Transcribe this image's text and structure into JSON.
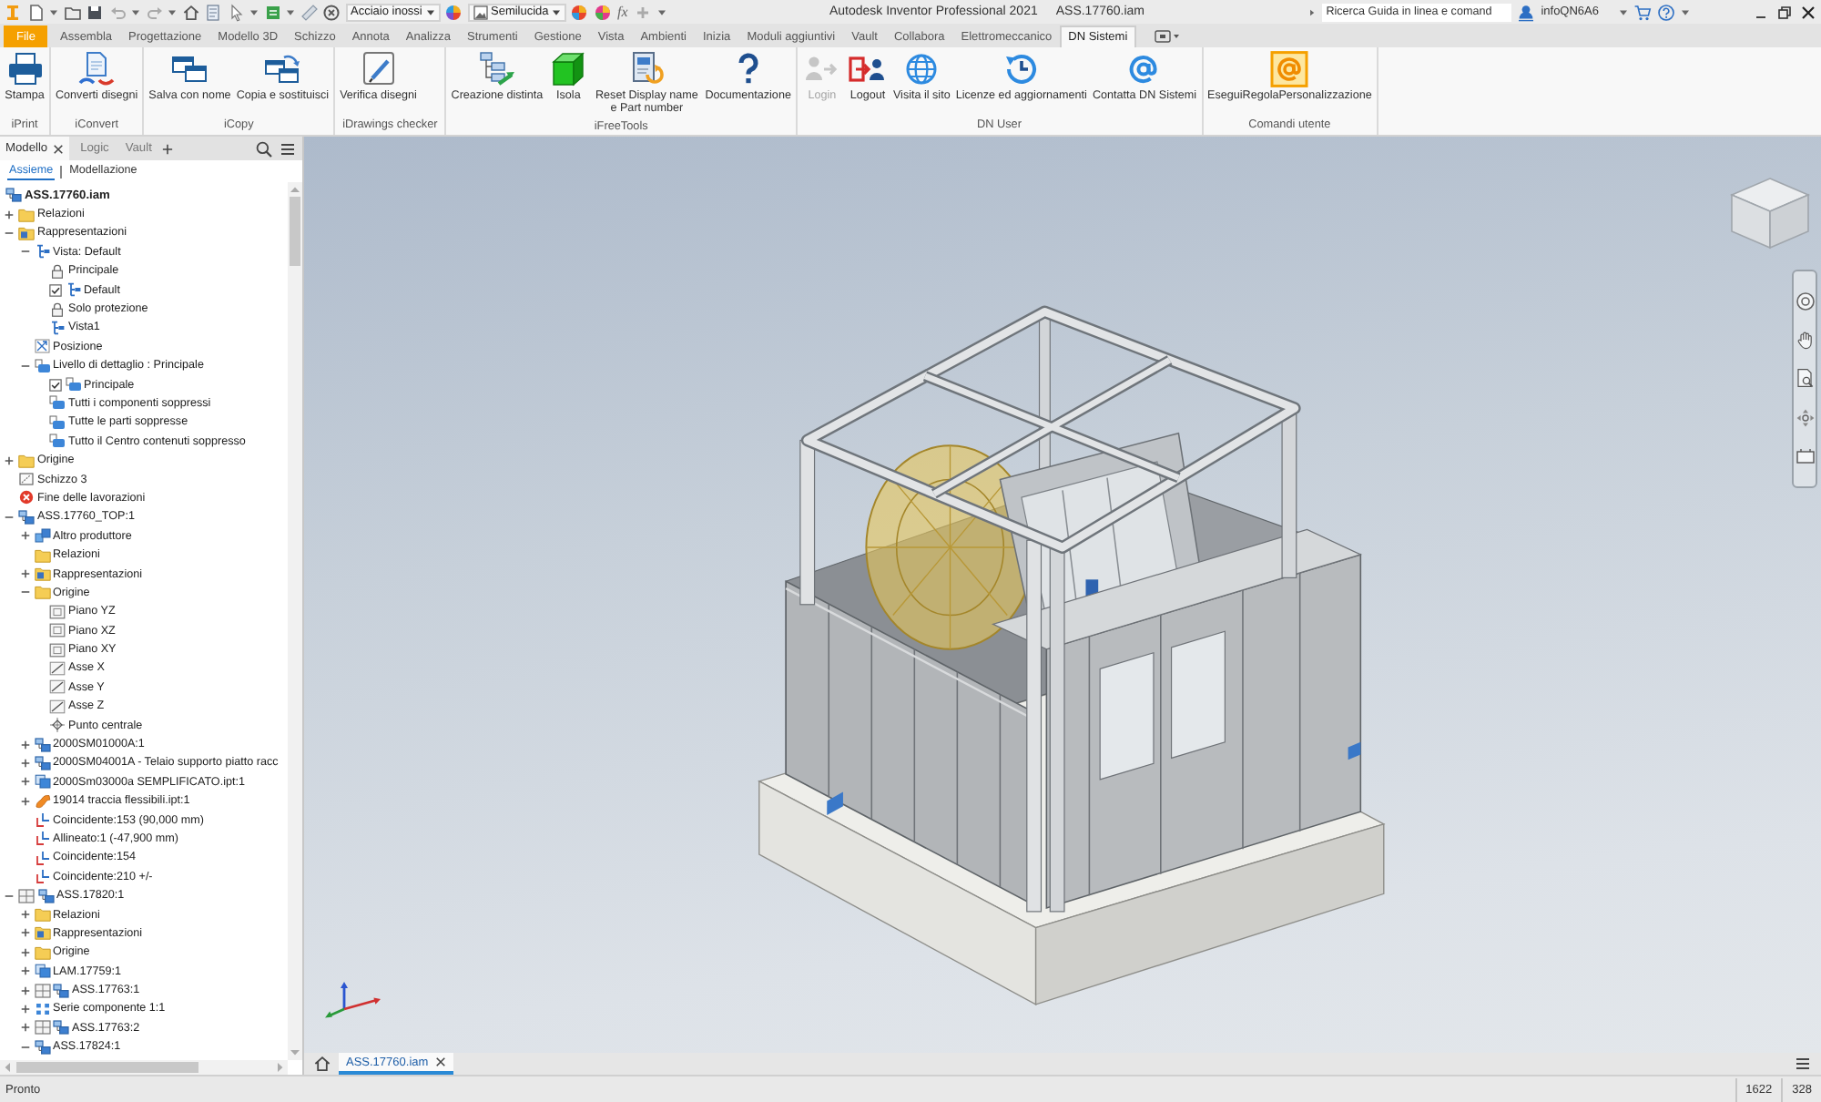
{
  "title_bar": {
    "material": "Acciaio inossi",
    "appearance": "Semilucida",
    "formula_button": "fx",
    "title": "Autodesk Inventor Professional 2021",
    "document": "ASS.17760.iam",
    "search": {
      "placeholder": "Ricerca Guida in linea e comand"
    },
    "user": "infoQN6A6"
  },
  "ribbon_tabs": [
    {
      "label": "File",
      "kind": "application_menu",
      "selected": false
    },
    {
      "label": "Assembla",
      "kind": "tab",
      "selected": false
    },
    {
      "label": "Progettazione",
      "kind": "tab",
      "selected": false
    },
    {
      "label": "Modello 3D",
      "kind": "tab",
      "selected": false
    },
    {
      "label": "Schizzo",
      "kind": "tab",
      "selected": false
    },
    {
      "label": "Annota",
      "kind": "tab",
      "selected": false
    },
    {
      "label": "Analizza",
      "kind": "tab",
      "selected": false
    },
    {
      "label": "Strumenti",
      "kind": "tab",
      "selected": false
    },
    {
      "label": "Gestione",
      "kind": "tab",
      "selected": false
    },
    {
      "label": "Vista",
      "kind": "tab",
      "selected": false
    },
    {
      "label": "Ambienti",
      "kind": "tab",
      "selected": false
    },
    {
      "label": "Inizia",
      "kind": "tab",
      "selected": false
    },
    {
      "label": "Moduli aggiuntivi",
      "kind": "tab",
      "selected": false
    },
    {
      "label": "Vault",
      "kind": "tab",
      "selected": false
    },
    {
      "label": "Collabora",
      "kind": "tab",
      "selected": false
    },
    {
      "label": "Elettromeccanico",
      "kind": "tab",
      "selected": false
    },
    {
      "label": "DN Sistemi",
      "kind": "tab",
      "selected": true
    }
  ],
  "ribbon_groups": [
    {
      "label": "iPrint",
      "buttons": [
        {
          "label": "Stampa"
        }
      ]
    },
    {
      "label": "iConvert",
      "buttons": [
        {
          "label": "Converti disegni"
        }
      ]
    },
    {
      "label": "iCopy",
      "buttons": [
        {
          "label": "Salva con nome"
        },
        {
          "label": "Copia e sostituisci"
        }
      ]
    },
    {
      "label": "iDrawings checker",
      "buttons": [
        {
          "label": "Verifica disegni"
        }
      ]
    },
    {
      "label": "iFreeTools",
      "buttons": [
        {
          "label": "Creazione distinta"
        },
        {
          "label": "Isola"
        },
        {
          "label": "Reset Display name e Part number"
        },
        {
          "label": "Documentazione"
        }
      ]
    },
    {
      "label": "DN User",
      "buttons": [
        {
          "label": "Login",
          "disabled": true
        },
        {
          "label": "Logout",
          "disabled": false
        },
        {
          "label": "Visita il sito",
          "disabled": false
        },
        {
          "label": "Licenze ed aggiornamenti",
          "disabled": false
        },
        {
          "label": "Contatta DN Sistemi",
          "disabled": false
        }
      ]
    },
    {
      "label": "Comandi utente",
      "buttons": [
        {
          "label": "EseguiRegolaPersonalizzazione"
        }
      ]
    }
  ],
  "browser": {
    "tabs": [
      {
        "label": "Modello",
        "selected": true
      },
      {
        "label": "Logic",
        "selected": false
      },
      {
        "label": "Vault",
        "selected": false
      }
    ],
    "modes": [
      {
        "label": "Assieme",
        "selected": true
      },
      {
        "label": "Modellazione",
        "selected": false
      }
    ],
    "tree": {
      "label": "ASS.17760.iam",
      "kind": "assembly",
      "children": [
        {
          "label": "Relazioni",
          "kind": "folder",
          "expanded": false
        },
        {
          "label": "Rappresentazioni",
          "kind": "representations",
          "expanded": true,
          "children": [
            {
              "label": "Vista: Default",
              "kind": "view",
              "expanded": true,
              "children": [
                {
                  "label": "Principale",
                  "kind": "lock",
                  "checked": false
                },
                {
                  "label": "Default",
                  "kind": "view",
                  "checked": true
                },
                {
                  "label": "Solo protezione",
                  "kind": "lock",
                  "checked": false
                },
                {
                  "label": "Vista1",
                  "kind": "view",
                  "checked": false
                }
              ]
            },
            {
              "label": "Posizione",
              "kind": "position"
            },
            {
              "label": "Livello di dettaglio : Principale",
              "kind": "lod",
              "expanded": true,
              "children": [
                {
                  "label": "Principale",
                  "kind": "lod",
                  "checked": true
                },
                {
                  "label": "Tutti i componenti soppressi",
                  "kind": "lod",
                  "checked": false
                },
                {
                  "label": "Tutte le parti soppresse",
                  "kind": "lod",
                  "checked": false
                },
                {
                  "label": "Tutto il Centro contenuti soppresso",
                  "kind": "lod",
                  "checked": false
                }
              ]
            }
          ]
        },
        {
          "label": "Origine",
          "kind": "folder",
          "expanded": false
        },
        {
          "label": "Schizzo 3",
          "kind": "sketch"
        },
        {
          "label": "Fine delle lavorazioni",
          "kind": "end_marker"
        },
        {
          "label": "ASS.17760_TOP:1",
          "kind": "assembly",
          "expanded": true,
          "children": [
            {
              "label": "Altro produttore",
              "kind": "third_party",
              "expanded": false
            },
            {
              "label": "Relazioni",
              "kind": "folder"
            },
            {
              "label": "Rappresentazioni",
              "kind": "representations",
              "expanded": false
            },
            {
              "label": "Origine",
              "kind": "folder",
              "expanded": true,
              "children": [
                {
                  "label": "Piano YZ",
                  "kind": "plane"
                },
                {
                  "label": "Piano XZ",
                  "kind": "plane"
                },
                {
                  "label": "Piano XY",
                  "kind": "plane"
                },
                {
                  "label": "Asse X",
                  "kind": "axis"
                },
                {
                  "label": "Asse Y",
                  "kind": "axis"
                },
                {
                  "label": "Asse Z",
                  "kind": "axis"
                },
                {
                  "label": "Punto centrale",
                  "kind": "point"
                }
              ]
            },
            {
              "label": "2000SM01000A:1",
              "kind": "assembly",
              "expanded": false
            },
            {
              "label": "2000SM04001A - Telaio supporto piatto racc",
              "kind": "assembly",
              "expanded": false
            },
            {
              "label": "2000Sm03000a SEMPLIFICATO.ipt:1",
              "kind": "part",
              "expanded": false
            },
            {
              "label": "19014 traccia flessibili.ipt:1",
              "kind": "flexible_part",
              "expanded": false
            },
            {
              "label": "Coincidente:153 (90,000 mm)",
              "kind": "constraint"
            },
            {
              "label": "Allineato:1 (-47,900 mm)",
              "kind": "constraint"
            },
            {
              "label": "Coincidente:154",
              "kind": "constraint"
            },
            {
              "label": "Coincidente:210 +/-",
              "kind": "constraint"
            }
          ]
        },
        {
          "label": "ASS.17820:1",
          "kind": "grounded_assembly",
          "expanded": true,
          "children": [
            {
              "label": "Relazioni",
              "kind": "folder",
              "expanded": false
            },
            {
              "label": "Rappresentazioni",
              "kind": "representations",
              "expanded": false
            },
            {
              "label": "Origine",
              "kind": "folder",
              "expanded": false
            },
            {
              "label": "LAM.17759:1",
              "kind": "part",
              "expanded": false
            },
            {
              "label": "ASS.17763:1",
              "kind": "grounded_assembly",
              "expanded": false
            },
            {
              "label": "Serie componente 1:1",
              "kind": "pattern",
              "expanded": false
            },
            {
              "label": "ASS.17763:2",
              "kind": "grounded_assembly",
              "expanded": false
            },
            {
              "label": "ASS.17824:1",
              "kind": "assembly",
              "expanded": true
            }
          ]
        }
      ]
    }
  },
  "document_tabs": [
    {
      "label": "ASS.17760.iam",
      "selected": true
    }
  ],
  "status_bar": {
    "message": "Pronto",
    "readouts": [
      "1622",
      "328"
    ]
  }
}
